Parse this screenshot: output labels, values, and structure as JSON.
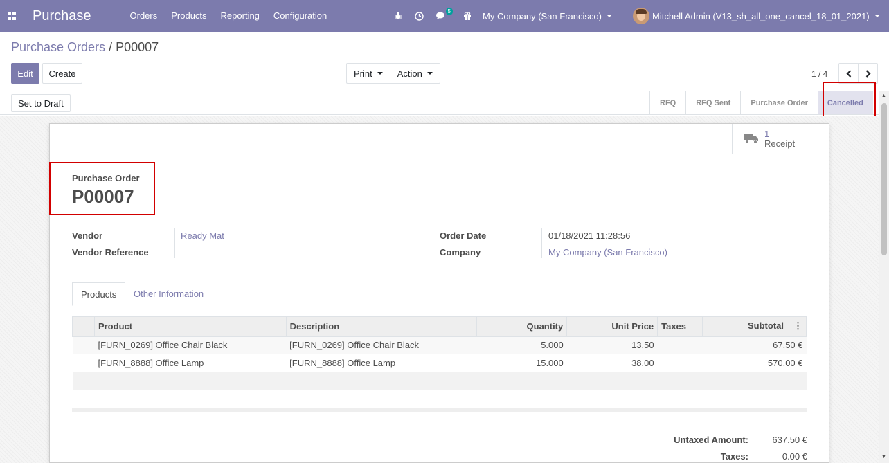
{
  "navbar": {
    "app_name": "Purchase",
    "menu": [
      "Orders",
      "Products",
      "Reporting",
      "Configuration"
    ],
    "messages_badge": "5",
    "company": "My Company (San Francisco)",
    "user": "Mitchell Admin (V13_sh_all_one_cancel_18_01_2021)",
    "icons": [
      "apps-icon",
      "bug-icon",
      "clock-icon",
      "chat-icon",
      "gift-icon"
    ]
  },
  "control_panel": {
    "breadcrumb_parent": "Purchase Orders",
    "breadcrumb_separator": " / ",
    "breadcrumb_current": "P00007",
    "edit_label": "Edit",
    "create_label": "Create",
    "print_label": "Print",
    "action_label": "Action",
    "pager": "1 / 4",
    "pager_value": "1",
    "pager_total": "4"
  },
  "statusbar": {
    "set_to_draft_label": "Set to Draft",
    "stages": [
      "RFQ",
      "RFQ Sent",
      "Purchase Order",
      "Cancelled"
    ],
    "active_stage": "Cancelled"
  },
  "smart_button": {
    "count": "1",
    "label": "Receipt",
    "icon": "truck-icon"
  },
  "form": {
    "title_label": "Purchase Order",
    "name": "P00007",
    "vendor_label": "Vendor",
    "vendor_value": "Ready Mat",
    "vendor_ref_label": "Vendor Reference",
    "vendor_ref_value": "",
    "order_date_label": "Order Date",
    "order_date_value": "01/18/2021 11:28:56",
    "company_label": "Company",
    "company_value": "My Company (San Francisco)"
  },
  "tabs": [
    "Products",
    "Other Information"
  ],
  "lines": {
    "headers": [
      "Product",
      "Description",
      "Quantity",
      "Unit Price",
      "Taxes",
      "Subtotal"
    ],
    "rows": [
      {
        "product": "[FURN_0269] Office Chair Black",
        "description": "[FURN_0269] Office Chair Black",
        "quantity": "5.000",
        "unit_price": "13.50",
        "taxes": "",
        "subtotal": "67.50 €"
      },
      {
        "product": "[FURN_8888] Office Lamp",
        "description": "[FURN_8888] Office Lamp",
        "quantity": "15.000",
        "unit_price": "38.00",
        "taxes": "",
        "subtotal": "570.00 €"
      }
    ]
  },
  "totals": {
    "untaxed_label": "Untaxed Amount:",
    "untaxed_value": "637.50 €",
    "taxes_label": "Taxes:",
    "taxes_value": "0.00 €"
  },
  "colors": {
    "brand": "#7c7bad",
    "highlight": "#d20000",
    "active_stage_bg": "#e2e2ee"
  }
}
